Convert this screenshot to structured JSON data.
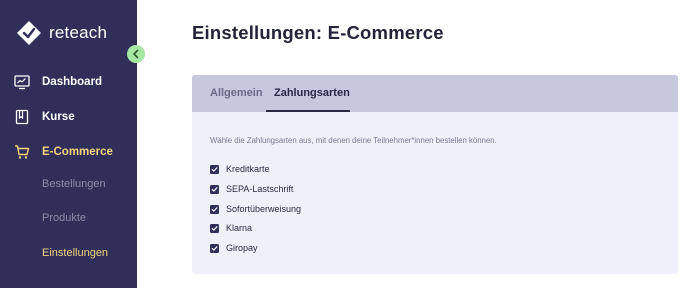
{
  "app": {
    "logo_text": "reteach"
  },
  "sidebar": {
    "items": [
      {
        "label": "Dashboard",
        "icon": "monitor-chart-icon"
      },
      {
        "label": "Kurse",
        "icon": "book-icon"
      },
      {
        "label": "E-Commerce",
        "icon": "shopping-cart-icon"
      }
    ],
    "subitems": [
      {
        "label": "Bestellungen"
      },
      {
        "label": "Produkte"
      },
      {
        "label": "Einstellungen"
      }
    ]
  },
  "page": {
    "title": "Einstellungen: E-Commerce"
  },
  "tabs": [
    {
      "label": "Allgemein",
      "active": false
    },
    {
      "label": "Zahlungsarten",
      "active": true
    }
  ],
  "payment": {
    "description": "Wähle die Zahlungsarten aus, mit denen deine Teilnehmer*innen bestellen können.",
    "options": [
      {
        "label": "Kreditkarte",
        "checked": true
      },
      {
        "label": "SEPA-Lastschrift",
        "checked": true
      },
      {
        "label": "Sofortüberweisung",
        "checked": true
      },
      {
        "label": "Klarna",
        "checked": true
      },
      {
        "label": "Giropay",
        "checked": true
      }
    ]
  },
  "colors": {
    "sidebar_bg": "#2f2f5a",
    "accent_active": "#f2d27a",
    "collapse_button": "#a8e6a3",
    "tabbar_bg": "#c7c7de",
    "card_bg": "#f0f0fa"
  }
}
